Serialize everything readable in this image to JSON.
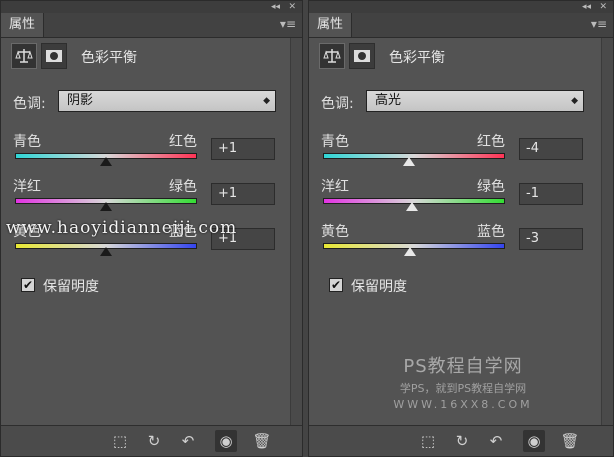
{
  "panels": [
    {
      "tab": "属性",
      "title": "色彩平衡",
      "tone_label": "色调:",
      "tone_value": "阴影",
      "sliders": [
        {
          "left": "青色",
          "right": "红色",
          "value": "+1",
          "level": 1
        },
        {
          "left": "洋红",
          "right": "绿色",
          "value": "+1",
          "level": 1
        },
        {
          "left": "黄色",
          "right": "蓝色",
          "value": "+1",
          "level": 1
        }
      ],
      "preserve_label": "保留明度",
      "preserve_checked": true
    },
    {
      "tab": "属性",
      "title": "色彩平衡",
      "tone_label": "色调:",
      "tone_value": "高光",
      "sliders": [
        {
          "left": "青色",
          "right": "红色",
          "value": "-4",
          "level": -4
        },
        {
          "left": "洋红",
          "right": "绿色",
          "value": "-1",
          "level": -1
        },
        {
          "left": "黄色",
          "right": "蓝色",
          "value": "-3",
          "level": -3
        }
      ],
      "preserve_label": "保留明度",
      "preserve_checked": true
    }
  ],
  "slider_range": [
    -100,
    100
  ],
  "slider_gradients": [
    [
      "#2fd6d6",
      "#ff3355"
    ],
    [
      "#e233e2",
      "#33dd33"
    ],
    [
      "#e8e833",
      "#3344ee"
    ]
  ],
  "icons": {
    "checkbox": "✔",
    "collapse": "◂◂",
    "close": "✕",
    "menu": "▾≡",
    "select_arrow": "◆",
    "clip": "⬚",
    "reset_view": "↻",
    "undo": "↶",
    "eye": "◉",
    "trash": "🗑"
  },
  "watermarks": {
    "url": "www.haoyidianneiji.com",
    "title": "PS教程自学网",
    "subtitle": "学PS，就到PS教程自学网",
    "site": "WWW.16XX8.COM"
  }
}
